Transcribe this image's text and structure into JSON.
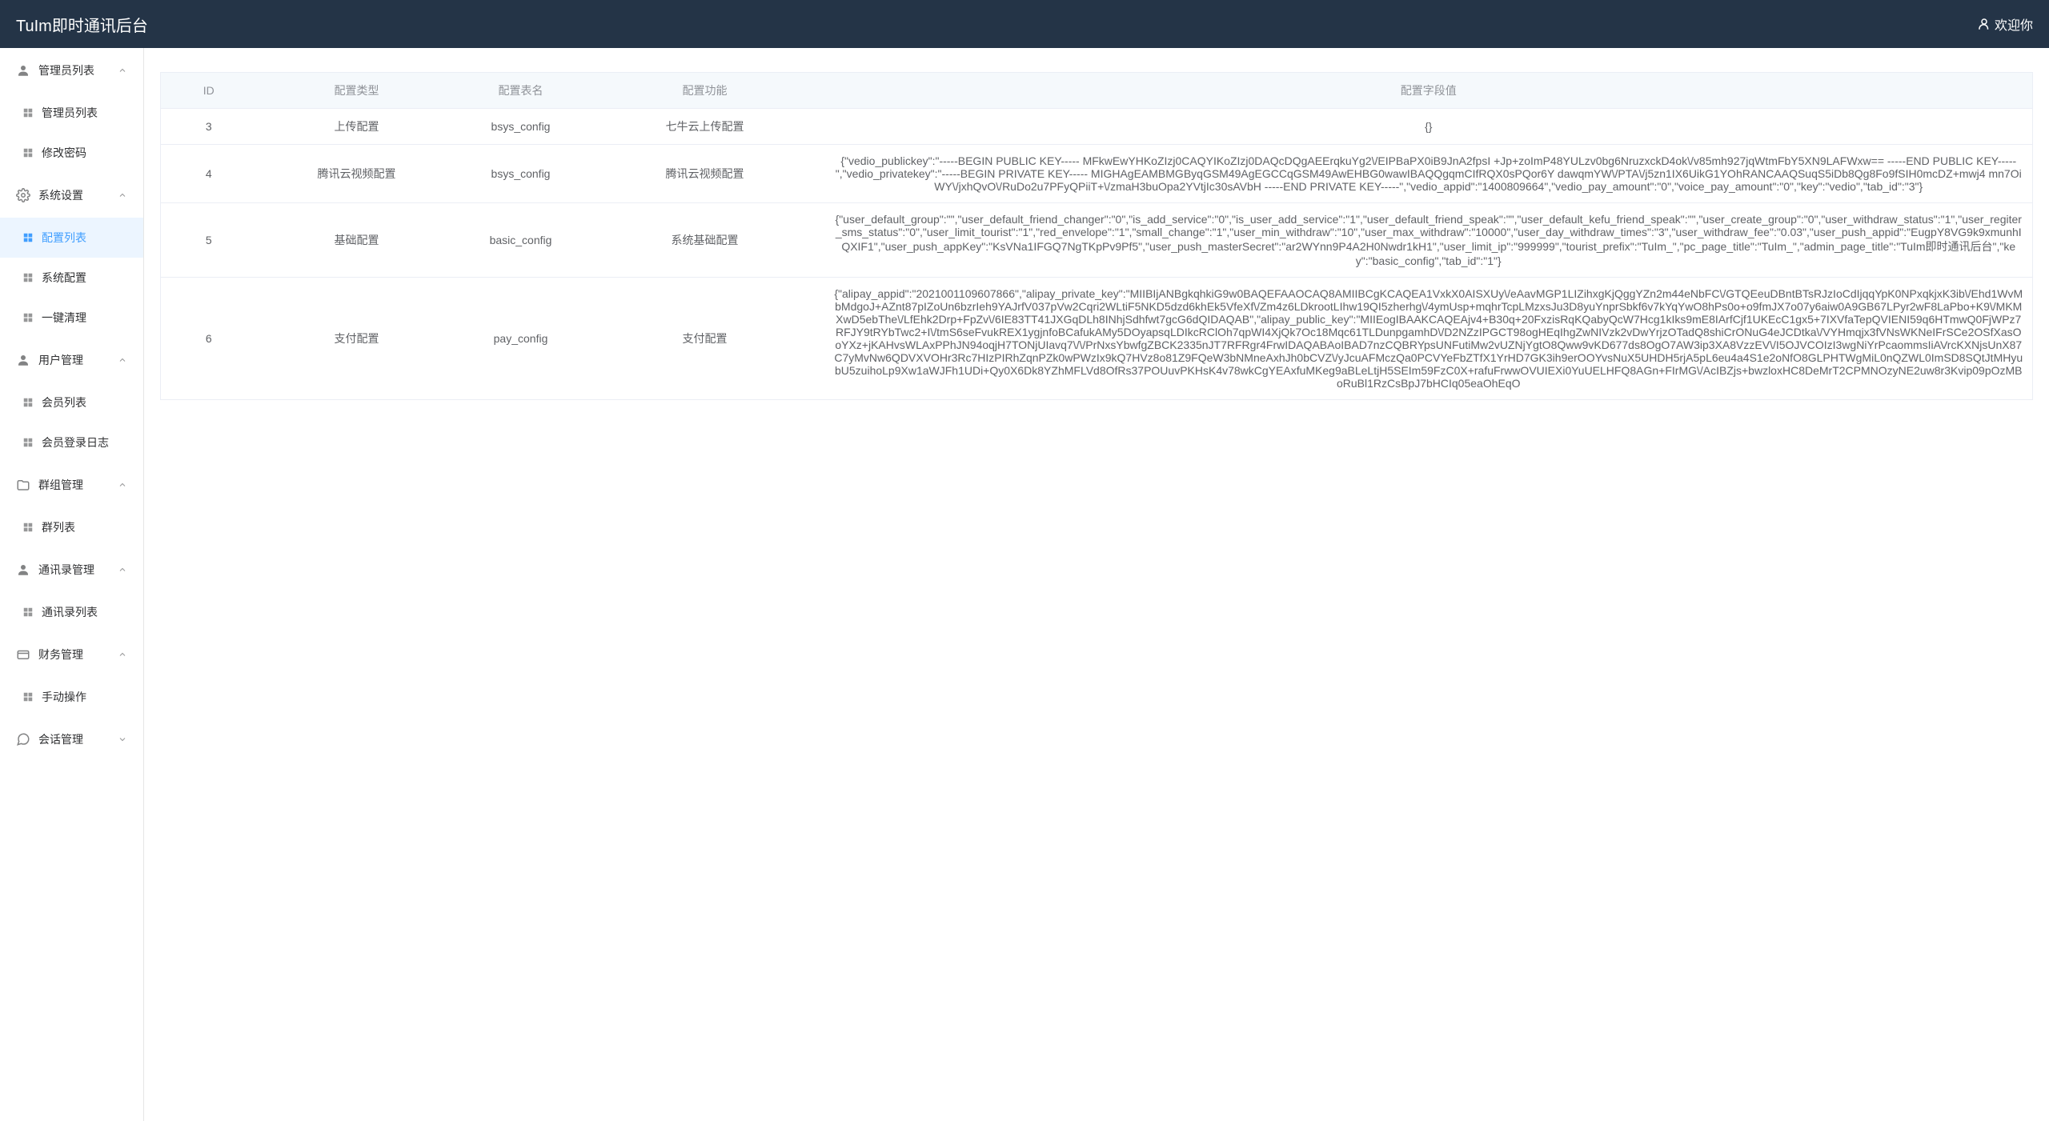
{
  "header": {
    "title": "TuIm即时通讯后台",
    "welcome": "欢迎你"
  },
  "sidebar": {
    "groups": [
      {
        "label": "管理员列表",
        "items": [
          {
            "label": "管理员列表",
            "name": "admin-list"
          },
          {
            "label": "修改密码",
            "name": "change-password"
          }
        ]
      },
      {
        "label": "系统设置",
        "items": [
          {
            "label": "配置列表",
            "name": "config-list",
            "active": true
          },
          {
            "label": "系统配置",
            "name": "system-config"
          },
          {
            "label": "一键清理",
            "name": "one-click-clean"
          }
        ]
      },
      {
        "label": "用户管理",
        "items": [
          {
            "label": "会员列表",
            "name": "member-list"
          },
          {
            "label": "会员登录日志",
            "name": "member-login-log"
          }
        ]
      },
      {
        "label": "群组管理",
        "items": [
          {
            "label": "群列表",
            "name": "group-list"
          }
        ]
      },
      {
        "label": "通讯录管理",
        "items": [
          {
            "label": "通讯录列表",
            "name": "contacts-list"
          }
        ]
      },
      {
        "label": "财务管理",
        "items": [
          {
            "label": "手动操作",
            "name": "manual-operation"
          }
        ]
      },
      {
        "label": "会话管理",
        "items": []
      }
    ]
  },
  "table": {
    "headers": {
      "id": "ID",
      "type": "配置类型",
      "table": "配置表名",
      "func": "配置功能",
      "value": "配置字段值"
    },
    "rows": [
      {
        "id": "3",
        "type": "上传配置",
        "table": "bsys_config",
        "func": "七牛云上传配置",
        "value": "{}"
      },
      {
        "id": "4",
        "type": "腾讯云视频配置",
        "table": "bsys_config",
        "func": "腾讯云视频配置",
        "value": "{\"vedio_publickey\":\"-----BEGIN PUBLIC KEY----- MFkwEwYHKoZIzj0CAQYIKoZIzj0DAQcDQgAEErqkuYg2\\/EIPBaPX0iB9JnA2fpsI +Jp+zoImP48YULzv0bg6NruzxckD4ok\\/v85mh927jqWtmFbY5XN9LAFWxw== -----END PUBLIC KEY-----\",\"vedio_privatekey\":\"-----BEGIN PRIVATE KEY----- MIGHAgEAMBMGByqGSM49AgEGCCqGSM49AwEHBG0wawIBAQQgqmCIfRQX0sPQor6Y dawqmYW\\/PTA\\/j5zn1IX6UikG1YOhRANCAAQSuqS5iDb8Qg8Fo9fSIH0mcDZ+mwj4 mn7OiWY\\/jxhQvO\\/RuDo2u7PFyQPiiT+\\/zmaH3buOpa2YVtjIc30sAVbH -----END PRIVATE KEY-----\",\"vedio_appid\":\"1400809664\",\"vedio_pay_amount\":\"0\",\"voice_pay_amount\":\"0\",\"key\":\"vedio\",\"tab_id\":\"3\"}"
      },
      {
        "id": "5",
        "type": "基础配置",
        "table": "basic_config",
        "func": "系统基础配置",
        "value": "{\"user_default_group\":\"\",\"user_default_friend_changer\":\"0\",\"is_add_service\":\"0\",\"is_user_add_service\":\"1\",\"user_default_friend_speak\":\"\",\"user_default_kefu_friend_speak\":\"\",\"user_create_group\":\"0\",\"user_withdraw_status\":\"1\",\"user_regiter_sms_status\":\"0\",\"user_limit_tourist\":\"1\",\"red_envelope\":\"1\",\"small_change\":\"1\",\"user_min_withdraw\":\"10\",\"user_max_withdraw\":\"10000\",\"user_day_withdraw_times\":\"3\",\"user_withdraw_fee\":\"0.03\",\"user_push_appid\":\"EugpY8VG9k9xmunhIQXIF1\",\"user_push_appKey\":\"KsVNa1IFGQ7NgTKpPv9Pf5\",\"user_push_masterSecret\":\"ar2WYnn9P4A2H0Nwdr1kH1\",\"user_limit_ip\":\"999999\",\"tourist_prefix\":\"TuIm_\",\"pc_page_title\":\"TuIm_\",\"admin_page_title\":\"TuIm即时通讯后台\",\"key\":\"basic_config\",\"tab_id\":\"1\"}"
      },
      {
        "id": "6",
        "type": "支付配置",
        "table": "pay_config",
        "func": "支付配置",
        "value": "{\"alipay_appid\":\"2021001109607866\",\"alipay_private_key\":\"MIIBIjANBgkqhkiG9w0BAQEFAAOCAQ8AMIIBCgKCAQEA1VxkX0AISXUy\\/eAavMGP1LIZihxgKjQggYZn2m44eNbFC\\/GTQEeuDBntBTsRJzIoCdIjqqYpK0NPxqkjxK3ib\\/Ehd1WvMbMdgoJ+AZnt87pIZoUn6bzrIeh9YAJrfV037pVw2Cqri2WLtiF5NKD5dzd6khEk5VfeXf\\/Zm4z6LDkrootLIhw19QI5zherhg\\/4ymUsp+mqhrTcpLMzxsJu3D8yuYnprSbkf6v7kYqYwO8hPs0o+o9fmJX7o07y6aiw0A9GB67LPyr2wF8LaPbo+K9\\/MKMXwD5ebThe\\/LfEhk2Drp+FpZv\\/6IE83TT41JXGqDLh8INhjSdhfwt7gcG6dQIDAQAB\",\"alipay_public_key\":\"MIIEogIBAAKCAQEAjv4+B30q+20FxzisRqKQabyQcW7Hcg1kIks9mE8IArfCjf1UKEcC1gx5+7IXVfaTepQVIENI59q6HTmwQ0FjWPz7RFJY9tRYbTwc2+I\\/tmS6seFvukREX1ygjnfoBCafukAMy5DOyapsqLDIkcRClOh7qpWI4XjQk7Oc18Mqc61TLDunpgamhD\\/D2NZzIPGCT98ogHEqIhgZwNIVzk2vDwYrjzOTadQ8shiCrONuG4eJCDtka\\/VYHmqjx3fVNsWKNeIFrSCe2OSfXasOoYXz+jKAHvsWLAxPPhJN94oqjH7TONjUIavq7\\/\\/PrNxsYbwfgZBCK2335nJT7RFRgr4FrwIDAQABAoIBAD7nzCQBRYpsUNFutiMw2vUZNjYgtO8Qww9vKD677ds8OgO7AW3ip3XA8VzzEV\\/I5OJVCOIzI3wgNiYrPcaommsIiAVrcKXNjsUnX87C7yMvNw6QDVXVOHr3Rc7HIzPIRhZqnPZk0wPWzIx9kQ7HVz8o81Z9FQeW3bNMneAxhJh0bCVZ\\/yJcuAFMczQa0PCVYeFbZTfX1YrHD7GK3ih9erOOYvsNuX5UHDH5rjA5pL6eu4a4S1e2oNfO8GLPHTWgMiL0nQZWL0ImSD8SQtJtMHyubU5zuihoLp9Xw1aWJFh1UDi+Qy0X6Dk8YZhMFLVd8OfRs37POUuvPKHsK4v78wkCgYEAxfuMKeg9aBLeLtjH5SEIm59FzC0X+rafuFrwwOVUIEXi0YuUELHFQ8AGn+FIrMG\\/AcIBZjs+bwzloxHC8DeMrT2CPMNOzyNE2uw8r3Kvip09pOzMBoRuBl1RzCsBpJ7bHCIq05eaOhEqO"
      }
    ]
  }
}
